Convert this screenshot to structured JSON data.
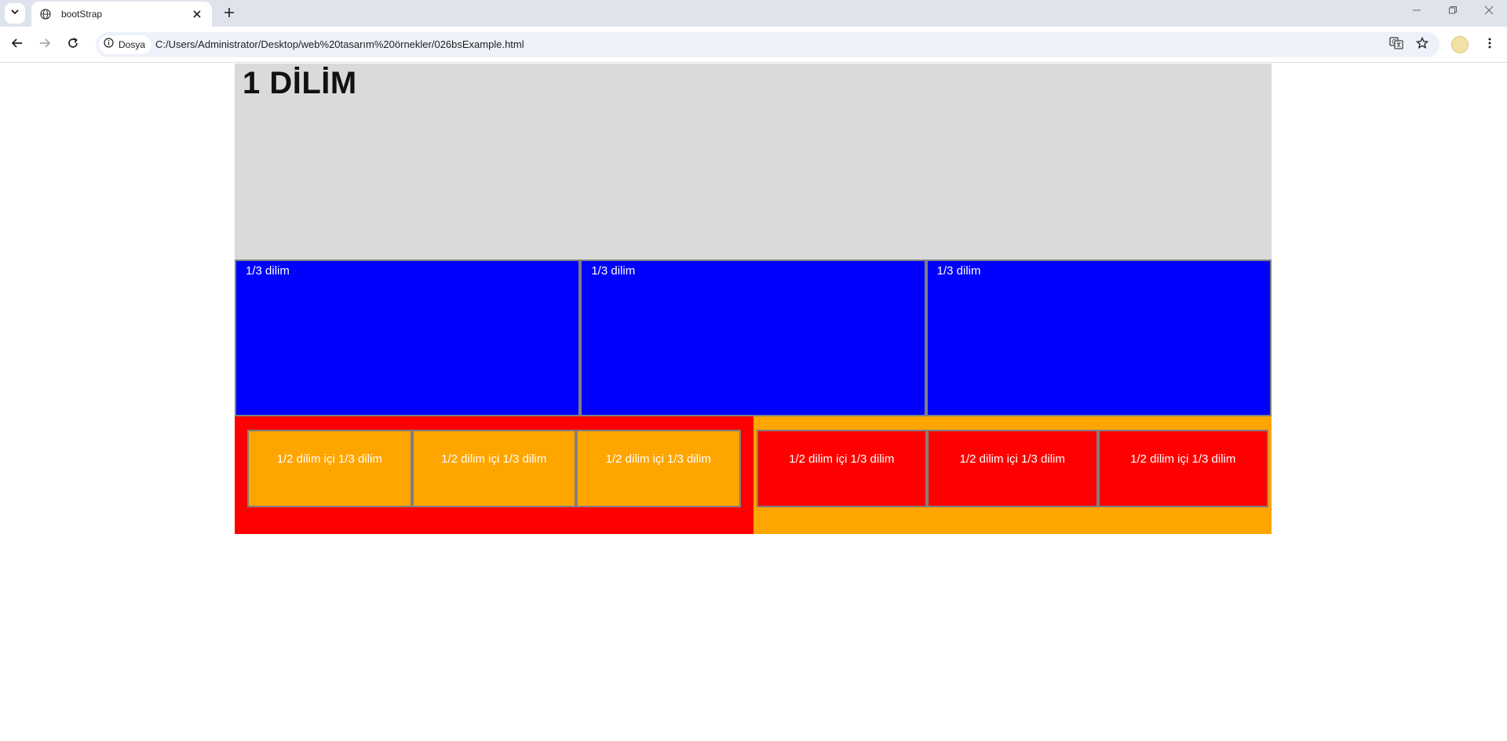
{
  "browser": {
    "tab_title": "bootStrap",
    "site_chip_label": "Dosya",
    "url": "C:/Users/Administrator/Desktop/web%20tasarım%20örnekler/026bsExample.html",
    "new_tab_symbol": "+",
    "close_tab_symbol": "✕"
  },
  "page": {
    "hero": {
      "title": "1 DİLİM",
      "color": "#dadada"
    },
    "thirds": {
      "color": "#0000ff",
      "items": [
        {
          "label": "1/3 dilim"
        },
        {
          "label": "1/3 dilim"
        },
        {
          "label": "1/3 dilim"
        }
      ]
    },
    "halves": {
      "left": {
        "bg_color": "#ff0000",
        "cell_color": "#ffa500",
        "cells": [
          {
            "label": "1/2 dilim içi 1/3 dilim"
          },
          {
            "label": "1/2 dilim içi 1/3 dilim"
          },
          {
            "label": "1/2 dilim içi 1/3 dilim"
          }
        ]
      },
      "right": {
        "bg_color": "#ffa500",
        "cell_color": "#ff0000",
        "cells": [
          {
            "label": "1/2 dilim içi 1/3 dilim"
          },
          {
            "label": "1/2 dilim içi 1/3 dilim"
          },
          {
            "label": "1/2 dilim içi 1/3 dilim"
          }
        ]
      }
    }
  }
}
